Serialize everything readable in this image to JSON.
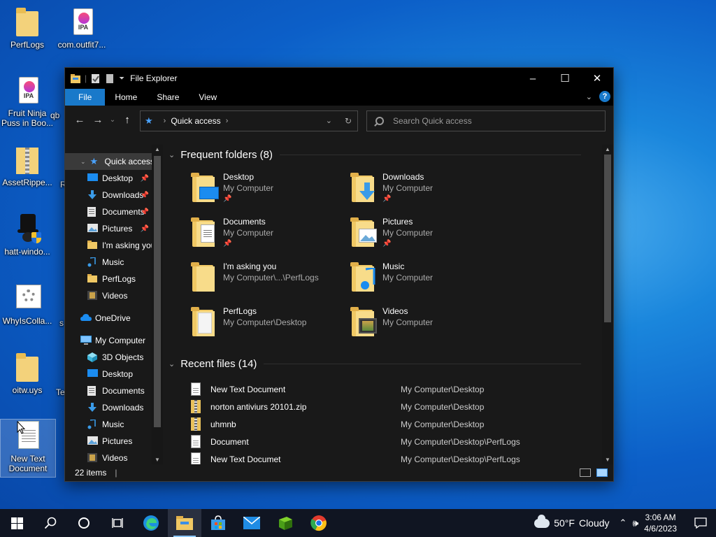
{
  "desktop": {
    "icons": [
      {
        "label": "PerfLogs",
        "icon": "folder-icon"
      },
      {
        "label": "com.outfit7...",
        "icon": "ipa-file-icon"
      },
      {
        "label": "Fruit Ninja Puss in Boo...",
        "icon": "ipa-file-icon"
      },
      {
        "label": "AssetRippe...",
        "icon": "zip-folder-icon"
      },
      {
        "label": "hatt-windo...",
        "icon": "hat-shield-icon"
      },
      {
        "label": "WhyIsColla...",
        "icon": "settings-file-icon"
      },
      {
        "label": "oitw.uys",
        "icon": "folder-icon"
      },
      {
        "label": "New Text Document",
        "icon": "text-document-icon"
      }
    ],
    "partial_labels": [
      "qb",
      "R",
      "s",
      "Te"
    ],
    "ipa_badge": "IPA"
  },
  "window": {
    "title": "File Explorer",
    "controls": {
      "minimize": "–",
      "maximize": "☐",
      "close": "✕"
    },
    "ribbon_tabs": [
      "File",
      "Home",
      "Share",
      "View"
    ],
    "help": "?",
    "address": {
      "location": "Quick access",
      "star": "★"
    },
    "search_placeholder": "Search Quick access",
    "nav": {
      "quick_access": "Quick access",
      "quick_items": [
        {
          "label": "Desktop",
          "icon": "desktop-icon",
          "pinned": true
        },
        {
          "label": "Downloads",
          "icon": "download-arrow-icon",
          "pinned": true
        },
        {
          "label": "Documents",
          "icon": "documents-icon",
          "pinned": true
        },
        {
          "label": "Pictures",
          "icon": "pictures-icon",
          "pinned": true
        },
        {
          "label": "I'm  asking you",
          "icon": "folder-icon",
          "pinned": false
        },
        {
          "label": "Music",
          "icon": "music-note-icon",
          "pinned": false
        },
        {
          "label": "PerfLogs",
          "icon": "folder-icon",
          "pinned": false
        },
        {
          "label": "Videos",
          "icon": "videos-icon",
          "pinned": false
        }
      ],
      "onedrive": "OneDrive",
      "my_computer": "My Computer",
      "computer_items": [
        {
          "label": "3D Objects",
          "icon": "cube-icon"
        },
        {
          "label": "Desktop",
          "icon": "desktop-icon"
        },
        {
          "label": "Documents",
          "icon": "documents-icon"
        },
        {
          "label": "Downloads",
          "icon": "download-arrow-icon"
        },
        {
          "label": "Music",
          "icon": "music-note-icon"
        },
        {
          "label": "Pictures",
          "icon": "pictures-icon"
        },
        {
          "label": "Videos",
          "icon": "videos-icon"
        }
      ]
    },
    "frequent": {
      "heading": "Frequent folders (8)",
      "items": [
        {
          "name": "Desktop",
          "location": "My Computer",
          "pinned": true,
          "overlay": "desktop"
        },
        {
          "name": "Downloads",
          "location": "My Computer",
          "pinned": true,
          "overlay": "download"
        },
        {
          "name": "Documents",
          "location": "My Computer",
          "pinned": true,
          "overlay": "documents"
        },
        {
          "name": "Pictures",
          "location": "My Computer",
          "pinned": true,
          "overlay": "pictures"
        },
        {
          "name": "I'm  asking you",
          "location": "My Computer\\...\\PerfLogs",
          "pinned": false,
          "overlay": "none"
        },
        {
          "name": "Music",
          "location": "My Computer",
          "pinned": false,
          "overlay": "music"
        },
        {
          "name": "PerfLogs",
          "location": "My Computer\\Desktop",
          "pinned": false,
          "overlay": "paper"
        },
        {
          "name": "Videos",
          "location": "My Computer",
          "pinned": false,
          "overlay": "videos"
        }
      ]
    },
    "recent": {
      "heading": "Recent files (14)",
      "items": [
        {
          "name": "New Text Document",
          "path": "My Computer\\Desktop",
          "type": "text"
        },
        {
          "name": "norton antiviurs 20101.zip",
          "path": "My Computer\\Desktop",
          "type": "zip"
        },
        {
          "name": "uhmnb",
          "path": "My Computer\\Desktop",
          "type": "zip"
        },
        {
          "name": "Document",
          "path": "My Computer\\Desktop\\PerfLogs",
          "type": "text"
        },
        {
          "name": "New Text Documet",
          "path": "My Computer\\Desktop\\PerfLogs",
          "type": "text"
        }
      ]
    },
    "status": {
      "count": "22 items",
      "bar": "|"
    }
  },
  "taskbar": {
    "weather": {
      "temp": "50°F",
      "condition": "Cloudy"
    },
    "time": "3:06 AM",
    "date": "4/6/2023"
  }
}
